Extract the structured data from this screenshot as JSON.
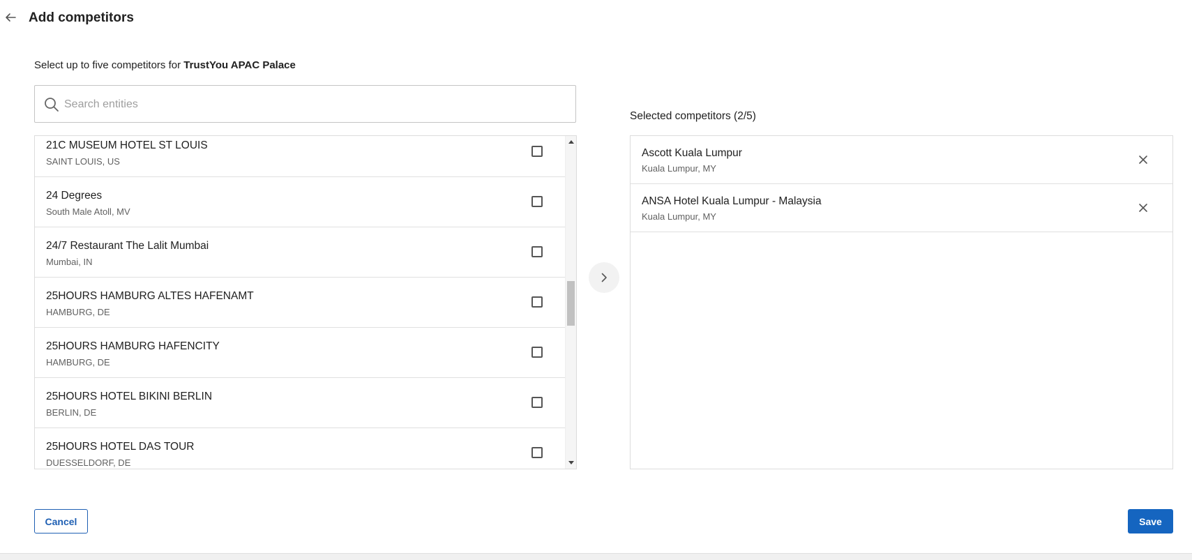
{
  "header": {
    "title": "Add competitors"
  },
  "subtitle": {
    "prefix": "Select up to five competitors for ",
    "entity": "TrustYou APAC Palace"
  },
  "search": {
    "placeholder": "Search entities",
    "value": ""
  },
  "entities": [
    {
      "name": "21C MUSEUM HOTEL ST LOUIS",
      "location": "SAINT LOUIS, US",
      "checked": false
    },
    {
      "name": "24 Degrees",
      "location": "South Male Atoll, MV",
      "checked": false
    },
    {
      "name": "24/7 Restaurant The Lalit Mumbai",
      "location": "Mumbai, IN",
      "checked": false
    },
    {
      "name": "25HOURS HAMBURG ALTES HAFENAMT",
      "location": "HAMBURG, DE",
      "checked": false
    },
    {
      "name": "25HOURS HAMBURG HAFENCITY",
      "location": "HAMBURG, DE",
      "checked": false
    },
    {
      "name": "25HOURS HOTEL BIKINI BERLIN",
      "location": "BERLIN, DE",
      "checked": false
    },
    {
      "name": "25HOURS HOTEL DAS TOUR",
      "location": "DUESSELDORF, DE",
      "checked": false
    }
  ],
  "selected": {
    "title": "Selected competitors (2/5)",
    "items": [
      {
        "name": "Ascott Kuala Lumpur",
        "location": "Kuala Lumpur, MY"
      },
      {
        "name": "ANSA Hotel Kuala Lumpur - Malaysia",
        "location": "Kuala Lumpur, MY"
      }
    ]
  },
  "actions": {
    "cancel_label": "Cancel",
    "save_label": "Save"
  },
  "icons": {
    "back": "arrow-left-icon",
    "search": "search-icon",
    "move": "chevron-right-icon",
    "remove": "close-icon"
  },
  "colors": {
    "primary": "#1565c0",
    "outline": "#1e5fb3"
  }
}
